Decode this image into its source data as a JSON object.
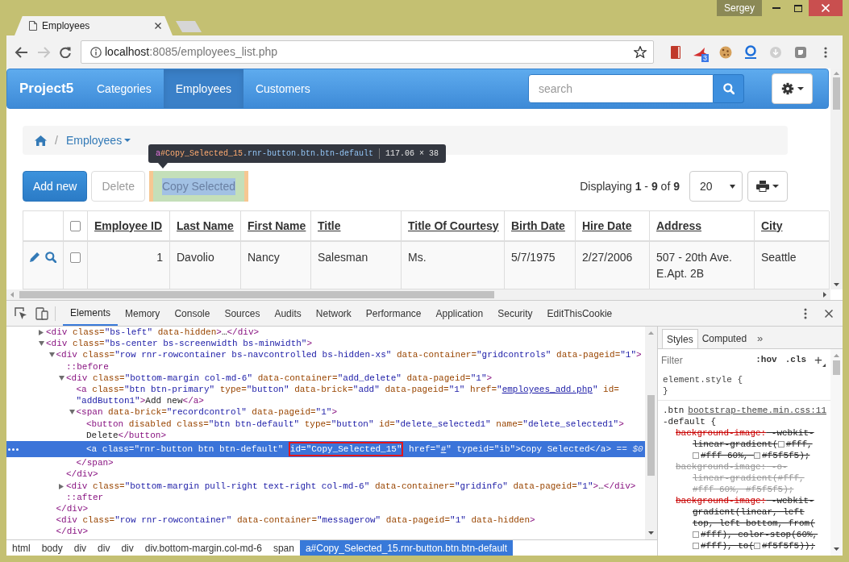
{
  "window": {
    "user": "Sergey"
  },
  "browser_tabs": [
    {
      "title": "Employees",
      "selected": true
    }
  ],
  "address_bar": {
    "host": "localhost",
    "path": ":8085/employees_list.php"
  },
  "extension_badge": "3",
  "navbar": {
    "brand": "Project5",
    "items": [
      {
        "label": "Categories",
        "selected": false
      },
      {
        "label": "Employees",
        "selected": true
      },
      {
        "label": "Customers",
        "selected": false
      }
    ],
    "search": {
      "placeholder": "search"
    }
  },
  "breadcrumb": {
    "separator": "/",
    "items": [
      "Employees"
    ]
  },
  "inspect_tooltip": {
    "tag": "a",
    "id": "#Copy_Selected_15",
    "classes": ".rnr-button.btn.btn-default",
    "size": "117.06 × 38"
  },
  "toolbar": {
    "buttons": [
      {
        "label": "Add new",
        "kind": "primary",
        "disabled": false,
        "highlighted": false
      },
      {
        "label": "Delete",
        "kind": "default",
        "disabled": true,
        "highlighted": false
      },
      {
        "label": "Copy Selected",
        "kind": "default",
        "disabled": false,
        "highlighted": true
      }
    ],
    "info": "Displaying **1** - **9** of **9**",
    "page_size": "20"
  },
  "table": {
    "header_checkbox": {
      "checked": false
    },
    "columns": [
      {
        "label": "Employee ID",
        "kind": "number"
      },
      {
        "label": "Last Name",
        "kind": "text"
      },
      {
        "label": "First Name",
        "kind": "text"
      },
      {
        "label": "Title",
        "kind": "text"
      },
      {
        "label": "Title Of Courtesy",
        "kind": "text"
      },
      {
        "label": "Birth Date",
        "kind": "text"
      },
      {
        "label": "Hire Date",
        "kind": "text"
      },
      {
        "label": "Address",
        "kind": "text"
      },
      {
        "label": "City",
        "kind": "text"
      }
    ],
    "rows": [
      {
        "checked": false,
        "cells": [
          "1",
          "Davolio",
          "Nancy",
          "Salesman",
          "Ms.",
          "5/7/1975",
          "2/27/2006",
          "507 - 20th Ave. E.Apt. 2B",
          "Seattle"
        ]
      }
    ]
  },
  "devtools": {
    "tabs": [
      {
        "label": "Elements",
        "selected": true
      },
      {
        "label": "Memory",
        "selected": false
      },
      {
        "label": "Console",
        "selected": false
      },
      {
        "label": "Sources",
        "selected": false
      },
      {
        "label": "Audits",
        "selected": false
      },
      {
        "label": "Network",
        "selected": false
      },
      {
        "label": "Performance",
        "selected": false
      },
      {
        "label": "Application",
        "selected": false
      },
      {
        "label": "Security",
        "selected": false
      },
      {
        "label": "EditThisCookie",
        "selected": false
      }
    ],
    "dom_tree": [
      {
        "selected": false,
        "expanded": false,
        "open": [
          {
            "kind": "tag",
            "text": "<div"
          },
          {
            "kind": "attr",
            "text": " class="
          },
          {
            "kind": "val",
            "text": "\"bs-left\""
          },
          {
            "kind": "attr",
            "text": " data-hidden"
          },
          {
            "kind": "tag",
            "text": ">"
          },
          {
            "kind": "text",
            "text": "…"
          },
          {
            "kind": "tag",
            "text": "</div>"
          }
        ]
      },
      {
        "selected": false,
        "expanded": true,
        "open": [
          {
            "kind": "tag",
            "text": "<div"
          },
          {
            "kind": "attr",
            "text": " class="
          },
          {
            "kind": "val",
            "text": "\"bs-center bs-screenwidth bs-minwidth\""
          },
          {
            "kind": "tag",
            "text": ">"
          }
        ],
        "children": [
          {
            "selected": false,
            "expanded": true,
            "open": [
              {
                "kind": "tag",
                "text": "<div"
              },
              {
                "kind": "attr",
                "text": " class="
              },
              {
                "kind": "val",
                "text": "\"row rnr-rowcontainer bs-navcontrolled bs-hidden-xs\""
              },
              {
                "kind": "attr",
                "text": " data-container="
              },
              {
                "kind": "val",
                "text": "\"gridcontrols\""
              },
              {
                "kind": "attr",
                "text": " data-pageid="
              },
              {
                "kind": "val",
                "text": "\"1\""
              },
              {
                "kind": "tag",
                "text": ">"
              }
            ],
            "children": [
              {
                "selected": false,
                "open": [
                  {
                    "kind": "pseudo",
                    "text": "::before"
                  }
                ]
              },
              {
                "selected": false,
                "expanded": true,
                "open": [
                  {
                    "kind": "tag",
                    "text": "<div"
                  },
                  {
                    "kind": "attr",
                    "text": " class="
                  },
                  {
                    "kind": "val",
                    "text": "\"bottom-margin col-md-6\""
                  },
                  {
                    "kind": "attr",
                    "text": " data-container="
                  },
                  {
                    "kind": "val",
                    "text": "\"add_delete\""
                  },
                  {
                    "kind": "attr",
                    "text": " data-pageid="
                  },
                  {
                    "kind": "val",
                    "text": "\"1\""
                  },
                  {
                    "kind": "tag",
                    "text": ">"
                  }
                ],
                "children": [
                  {
                    "selected": false,
                    "open": [
                      {
                        "kind": "tag",
                        "text": "<a"
                      },
                      {
                        "kind": "attr",
                        "text": " class="
                      },
                      {
                        "kind": "val",
                        "text": "\"btn btn-primary\""
                      },
                      {
                        "kind": "attr",
                        "text": " type="
                      },
                      {
                        "kind": "val",
                        "text": "\"button\""
                      },
                      {
                        "kind": "attr",
                        "text": " data-brick="
                      },
                      {
                        "kind": "val",
                        "text": "\"add\""
                      },
                      {
                        "kind": "attr",
                        "text": " data-pageid="
                      },
                      {
                        "kind": "val",
                        "text": "\"1\""
                      },
                      {
                        "kind": "attr",
                        "text": " href="
                      },
                      {
                        "kind": "val",
                        "text": "\""
                      },
                      {
                        "kind": "link",
                        "text": "employees_add.php"
                      },
                      {
                        "kind": "val",
                        "text": "\""
                      },
                      {
                        "kind": "attr",
                        "text": " id="
                      },
                      {
                        "kind": "val",
                        "text": "\"addButton1\""
                      },
                      {
                        "kind": "tag",
                        "text": ">"
                      },
                      {
                        "kind": "text",
                        "text": "Add new"
                      },
                      {
                        "kind": "tag",
                        "text": "</a>"
                      }
                    ]
                  },
                  {
                    "selected": false,
                    "expanded": true,
                    "open": [
                      {
                        "kind": "tag",
                        "text": "<span"
                      },
                      {
                        "kind": "attr",
                        "text": " data-brick="
                      },
                      {
                        "kind": "val",
                        "text": "\"recordcontrol\""
                      },
                      {
                        "kind": "attr",
                        "text": " data-pageid="
                      },
                      {
                        "kind": "val",
                        "text": "\"1\""
                      },
                      {
                        "kind": "tag",
                        "text": ">"
                      }
                    ],
                    "children": [
                      {
                        "selected": false,
                        "open": [
                          {
                            "kind": "tag",
                            "text": "<button"
                          },
                          {
                            "kind": "attr",
                            "text": " disabled"
                          },
                          {
                            "kind": "attr",
                            "text": " class="
                          },
                          {
                            "kind": "val",
                            "text": "\"btn btn-default\""
                          },
                          {
                            "kind": "attr",
                            "text": " type="
                          },
                          {
                            "kind": "val",
                            "text": "\"button\""
                          },
                          {
                            "kind": "attr",
                            "text": " id="
                          },
                          {
                            "kind": "val",
                            "text": "\"delete_selected1\""
                          },
                          {
                            "kind": "attr",
                            "text": " name="
                          },
                          {
                            "kind": "val",
                            "text": "\"delete_selected1\""
                          },
                          {
                            "kind": "tag",
                            "text": ">"
                          },
                          {
                            "kind": "text",
                            "text": "Delete"
                          },
                          {
                            "kind": "tag",
                            "text": "</button>"
                          }
                        ]
                      },
                      {
                        "selected": true,
                        "open": [
                          {
                            "kind": "tag",
                            "text": "<a"
                          },
                          {
                            "kind": "attr",
                            "text": " class="
                          },
                          {
                            "kind": "val",
                            "text": "\"rnr-button btn btn-default\" "
                          },
                          {
                            "kind": "boxed",
                            "text": "id=\"Copy_Selected_15\""
                          },
                          {
                            "kind": "attr",
                            "text": " href="
                          },
                          {
                            "kind": "val",
                            "text": "\""
                          },
                          {
                            "kind": "link",
                            "text": "#"
                          },
                          {
                            "kind": "val",
                            "text": "\""
                          },
                          {
                            "kind": "attr",
                            "text": " typeid="
                          },
                          {
                            "kind": "val",
                            "text": "\"ib\""
                          },
                          {
                            "kind": "tag",
                            "text": ">"
                          },
                          {
                            "kind": "text",
                            "text": "Copy Selected"
                          },
                          {
                            "kind": "tag",
                            "text": "</a>"
                          },
                          {
                            "kind": "note",
                            "text": " == $0"
                          }
                        ]
                      }
                    ],
                    "close": [
                      {
                        "kind": "tag",
                        "text": "</span>"
                      }
                    ]
                  }
                ],
                "close": [
                  {
                    "kind": "tag",
                    "text": "</div>"
                  }
                ]
              },
              {
                "selected": false,
                "expanded": false,
                "open": [
                  {
                    "kind": "tag",
                    "text": "<div"
                  },
                  {
                    "kind": "attr",
                    "text": " class="
                  },
                  {
                    "kind": "val",
                    "text": "\"bottom-margin pull-right text-right col-md-6\""
                  },
                  {
                    "kind": "attr",
                    "text": " data-container="
                  },
                  {
                    "kind": "val",
                    "text": "\"gridinfo\""
                  },
                  {
                    "kind": "attr",
                    "text": " data-pageid="
                  },
                  {
                    "kind": "val",
                    "text": "\"1\""
                  },
                  {
                    "kind": "tag",
                    "text": ">"
                  },
                  {
                    "kind": "text",
                    "text": "…"
                  },
                  {
                    "kind": "tag",
                    "text": "</div>"
                  }
                ]
              },
              {
                "selected": false,
                "open": [
                  {
                    "kind": "pseudo",
                    "text": "::after"
                  }
                ]
              }
            ],
            "close": [
              {
                "kind": "tag",
                "text": "</div>"
              }
            ]
          },
          {
            "selected": false,
            "open": [
              {
                "kind": "tag",
                "text": "<div"
              },
              {
                "kind": "attr",
                "text": " class="
              },
              {
                "kind": "val",
                "text": "\"row rnr-rowcontainer\""
              },
              {
                "kind": "attr",
                "text": " data-container="
              },
              {
                "kind": "val",
                "text": "\"messagerow\""
              },
              {
                "kind": "attr",
                "text": " data-pageid="
              },
              {
                "kind": "val",
                "text": "\"1\""
              },
              {
                "kind": "attr",
                "text": " data-hidden"
              },
              {
                "kind": "tag",
                "text": ">"
              }
            ],
            "close": [
              {
                "kind": "tag",
                "text": "</div>"
              }
            ]
          }
        ]
      }
    ],
    "breadcrumbs": [
      {
        "label": "html",
        "selected": false
      },
      {
        "label": "body",
        "selected": false
      },
      {
        "label": "div",
        "selected": false
      },
      {
        "label": "div",
        "selected": false
      },
      {
        "label": "div",
        "selected": false
      },
      {
        "label": "div.bottom-margin.col-md-6",
        "selected": false
      },
      {
        "label": "span",
        "selected": false
      },
      {
        "label": "a#Copy_Selected_15.rnr-button.btn.btn-default",
        "selected": true
      }
    ],
    "styles": {
      "tabs": [
        {
          "label": "Styles",
          "selected": true
        },
        {
          "label": "Computed",
          "selected": false
        }
      ],
      "more": "»",
      "filter": {
        "placeholder": "Filter"
      },
      "toggles": [
        ":hov",
        ".cls"
      ],
      "add": "+",
      "element_style": [
        "element.style {",
        "}"
      ],
      "rules": [
        {
          "source": "bootstrap-theme.min.css:11",
          "selector": [
            ".btn",
            "-default {"
          ],
          "declarations": [
            {
              "kind": "overridden",
              "name": "background-image:",
              "value": [
                {
                  "text": " -webkit-linear-gradient("
                },
                {
                  "color": "#ffffff",
                  "text": "#fff, "
                },
                {
                  "color": "#ffffff",
                  "text": "#fff 60%, "
                },
                {
                  "color": "#f5f5f5",
                  "text": "#f5f5f5);"
                }
              ]
            },
            {
              "kind": "inactive",
              "name": "background-image:",
              "value": [
                {
                  "text": " -o-linear-gradient(#fff, #fff 60%, #f5f5f5);"
                }
              ]
            },
            {
              "kind": "overridden",
              "name": "background-image:",
              "value": [
                {
                  "text": " -webkit-gradient(linear, left top, left bottom, from("
                },
                {
                  "color": "#ffffff",
                  "text": "#fff), color-stop(60%, "
                },
                {
                  "color": "#ffffff",
                  "text": "#fff), to("
                },
                {
                  "color": "#f5f5f5",
                  "text": "#f5f5f5));"
                }
              ]
            }
          ]
        }
      ]
    }
  }
}
